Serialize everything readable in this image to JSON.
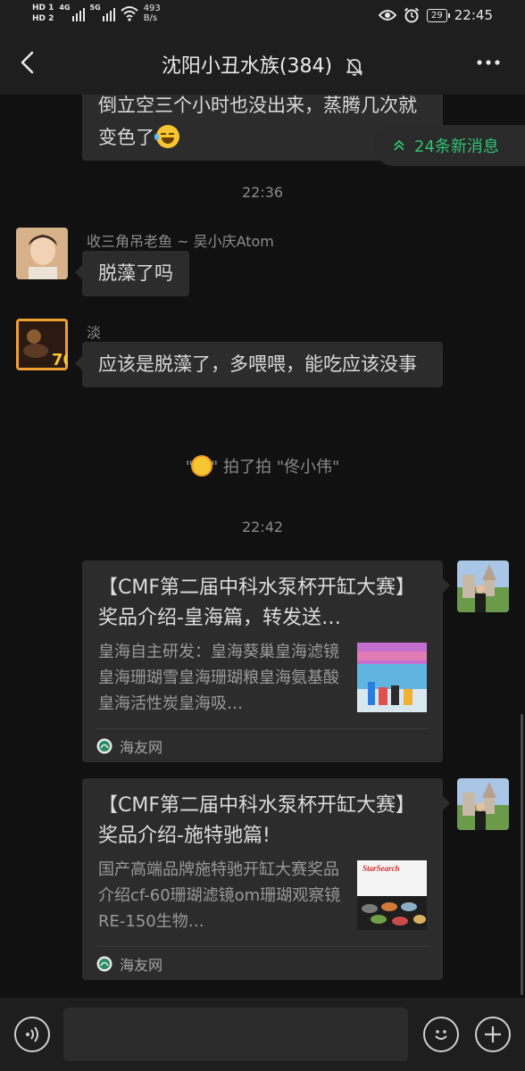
{
  "status_bar": {
    "hd1": "HD 1",
    "hd2": "HD 2",
    "net1": "4G",
    "net2": "5G",
    "speed_value": "493",
    "speed_unit": "B/s",
    "battery": "29",
    "time": "22:45"
  },
  "header": {
    "title": "沈阳小丑水族(384)",
    "back_icon": "back-arrow-icon",
    "mute_icon": "bell-off-icon",
    "more_icon": "more-dots-icon"
  },
  "new_messages": "24条新消息",
  "messages": [
    {
      "type": "text",
      "text": "倒立空三个小时也没出来，蒸腾几次就变色了"
    },
    {
      "type": "time",
      "text": "22:36"
    },
    {
      "type": "text",
      "sender": "收三角吊老鱼 ~ 吴小庆Atom",
      "text": "脱藻了吗"
    },
    {
      "type": "text",
      "sender": "淡",
      "text": "应该是脱藻了，多喂喂，能吃应该没事"
    },
    {
      "type": "system",
      "pre": "\"",
      "post": "\" 拍了拍 \"佟小伟\""
    },
    {
      "type": "time",
      "text": "22:42"
    },
    {
      "type": "link",
      "title": "【CMF第二届中科水泵杯开缸大赛】奖品介绍-皇海篇，转发送…",
      "desc": "皇海自主研发：皇海葵巢皇海滤镜皇海珊瑚雪皇海珊瑚粮皇海氨基酸皇海活性炭皇海吸…",
      "source": "海友网"
    },
    {
      "type": "link",
      "title": "【CMF第二届中科水泵杯开缸大赛】奖品介绍-施特驰篇!",
      "desc": "国产高端品牌施特驰开缸大赛奖品介绍cf-60珊瑚滤镜om珊瑚观察镜RE-150生物…",
      "source": "海友网",
      "thumb_brand": "StarSearch"
    }
  ],
  "colors": {
    "accent_green": "#2fc174",
    "bubble_bg": "#2c2c2c",
    "background": "#111111"
  }
}
